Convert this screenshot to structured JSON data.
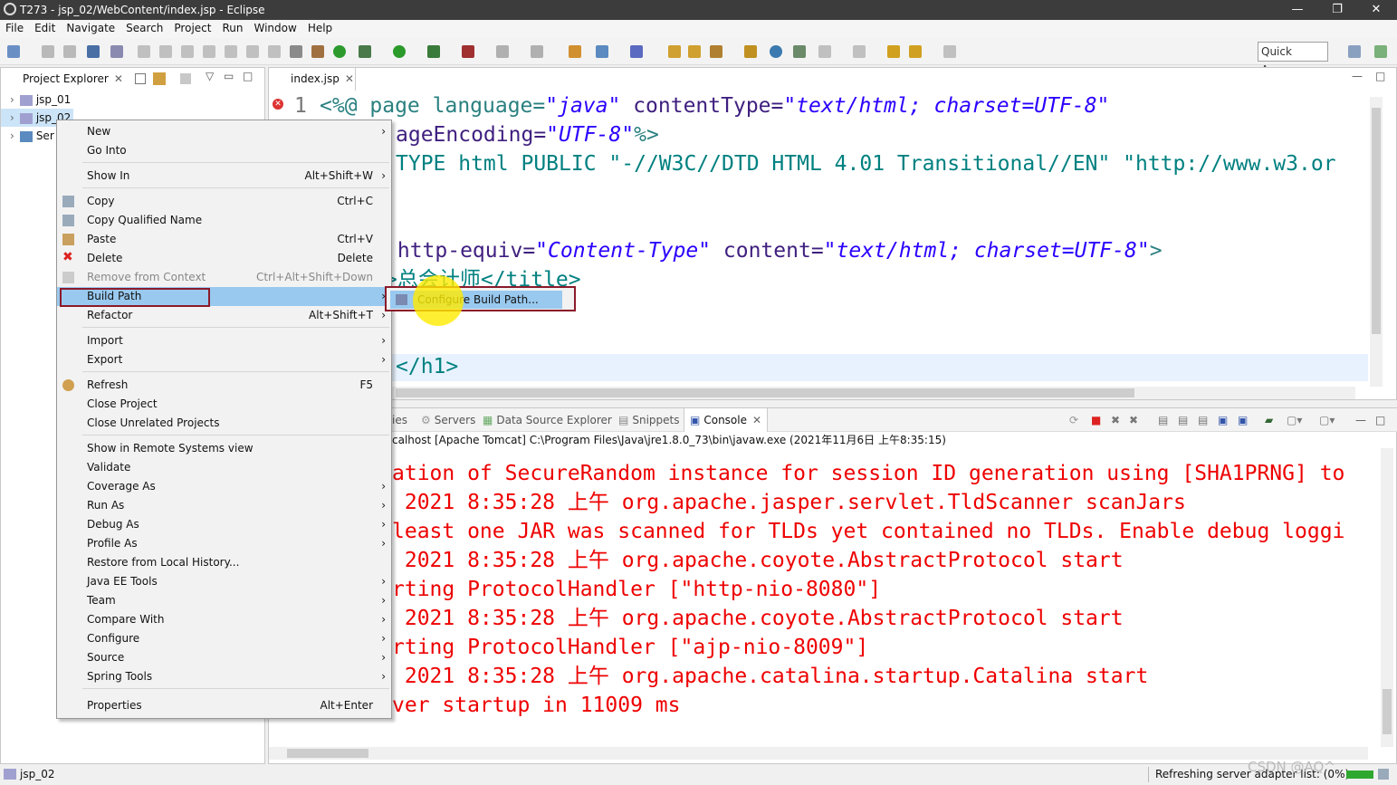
{
  "window": {
    "title": "T273 - jsp_02/WebContent/index.jsp - Eclipse",
    "minimize": "—",
    "maximize": "❐",
    "close": "✕"
  },
  "menubar": [
    "File",
    "Edit",
    "Navigate",
    "Search",
    "Project",
    "Run",
    "Window",
    "Help"
  ],
  "toolbar": {
    "quick_access": "Quick Access"
  },
  "project_explorer": {
    "tab_label": "Project Explorer",
    "items": [
      "jsp_01",
      "jsp_02",
      "Ser"
    ]
  },
  "editor": {
    "tab_label": "index.jsp",
    "line_number": "1",
    "lines": [
      [
        "<%@ page language=",
        "\"java\"",
        " contentType=",
        "\"text/html; charset=UTF-8\""
      ],
      [
        "ageEncoding=",
        "\"UTF-8\"",
        "%>"
      ],
      [
        "TYPE html PUBLIC \"-//W3C//DTD HTML 4.01 Transitional//EN\" \"http://www.w3.or"
      ],
      [
        " http-equiv=",
        "\"Content-Type\"",
        " content=",
        "\"text/html; charset=UTF-8\"",
        ">"
      ],
      [
        ">总会计师</title>"
      ],
      [
        "</h1>"
      ]
    ]
  },
  "console": {
    "tabs": [
      "ies",
      "Servers",
      "Data Source Explorer",
      "Snippets",
      "Console"
    ],
    "subtitle": "calhost [Apache Tomcat] C:\\Program Files\\Java\\jre1.8.0_73\\bin\\javaw.exe (2021年11月6日 上午8:35:15)",
    "lines": [
      "ation of SecureRandom instance for session ID generation using [SHA1PRNG] to",
      " 2021 8:35:28 上午 org.apache.jasper.servlet.TldScanner scanJars",
      "least one JAR was scanned for TLDs yet contained no TLDs. Enable debug loggi",
      " 2021 8:35:28 上午 org.apache.coyote.AbstractProtocol start",
      "rting ProtocolHandler [\"http-nio-8080\"]",
      " 2021 8:35:28 上午 org.apache.coyote.AbstractProtocol start",
      "rting ProtocolHandler [\"ajp-nio-8009\"]",
      " 2021 8:35:28 上午 org.apache.catalina.startup.Catalina start",
      "ver startup in 11009 ms"
    ]
  },
  "context_menu": {
    "items": [
      {
        "label": "New",
        "shortcut": "",
        "submenu": true
      },
      {
        "label": "Go Into",
        "shortcut": "",
        "submenu": false
      },
      {
        "label": "Show In",
        "shortcut": "Alt+Shift+W",
        "submenu": true
      },
      {
        "label": "Copy",
        "shortcut": "Ctrl+C",
        "submenu": false
      },
      {
        "label": "Copy Qualified Name",
        "shortcut": "",
        "submenu": false
      },
      {
        "label": "Paste",
        "shortcut": "Ctrl+V",
        "submenu": false
      },
      {
        "label": "Delete",
        "shortcut": "Delete",
        "submenu": false
      },
      {
        "label": "Remove from Context",
        "shortcut": "Ctrl+Alt+Shift+Down",
        "submenu": false
      },
      {
        "label": "Build Path",
        "shortcut": "",
        "submenu": true
      },
      {
        "label": "Refactor",
        "shortcut": "Alt+Shift+T",
        "submenu": true
      },
      {
        "label": "Import",
        "shortcut": "",
        "submenu": true
      },
      {
        "label": "Export",
        "shortcut": "",
        "submenu": true
      },
      {
        "label": "Refresh",
        "shortcut": "F5",
        "submenu": false
      },
      {
        "label": "Close Project",
        "shortcut": "",
        "submenu": false
      },
      {
        "label": "Close Unrelated Projects",
        "shortcut": "",
        "submenu": false
      },
      {
        "label": "Show in Remote Systems view",
        "shortcut": "",
        "submenu": false
      },
      {
        "label": "Validate",
        "shortcut": "",
        "submenu": false
      },
      {
        "label": "Coverage As",
        "shortcut": "",
        "submenu": true
      },
      {
        "label": "Run As",
        "shortcut": "",
        "submenu": true
      },
      {
        "label": "Debug As",
        "shortcut": "",
        "submenu": true
      },
      {
        "label": "Profile As",
        "shortcut": "",
        "submenu": true
      },
      {
        "label": "Restore from Local History...",
        "shortcut": "",
        "submenu": false
      },
      {
        "label": "Java EE Tools",
        "shortcut": "",
        "submenu": true
      },
      {
        "label": "Team",
        "shortcut": "",
        "submenu": true
      },
      {
        "label": "Compare With",
        "shortcut": "",
        "submenu": true
      },
      {
        "label": "Configure",
        "shortcut": "",
        "submenu": true
      },
      {
        "label": "Source",
        "shortcut": "",
        "submenu": true
      },
      {
        "label": "Spring Tools",
        "shortcut": "",
        "submenu": true
      },
      {
        "label": "Properties",
        "shortcut": "Alt+Enter",
        "submenu": false
      }
    ],
    "submenu_item": "Configure Build Path..."
  },
  "statusbar": {
    "left": "jsp_02",
    "right": "Refreshing server adapter list: (0%)",
    "watermark": "CSDN @AQ^"
  },
  "colors": {
    "accent": "#99c9ef",
    "highlight_box": "#8b1a2a",
    "console_text": "#ee0000"
  }
}
